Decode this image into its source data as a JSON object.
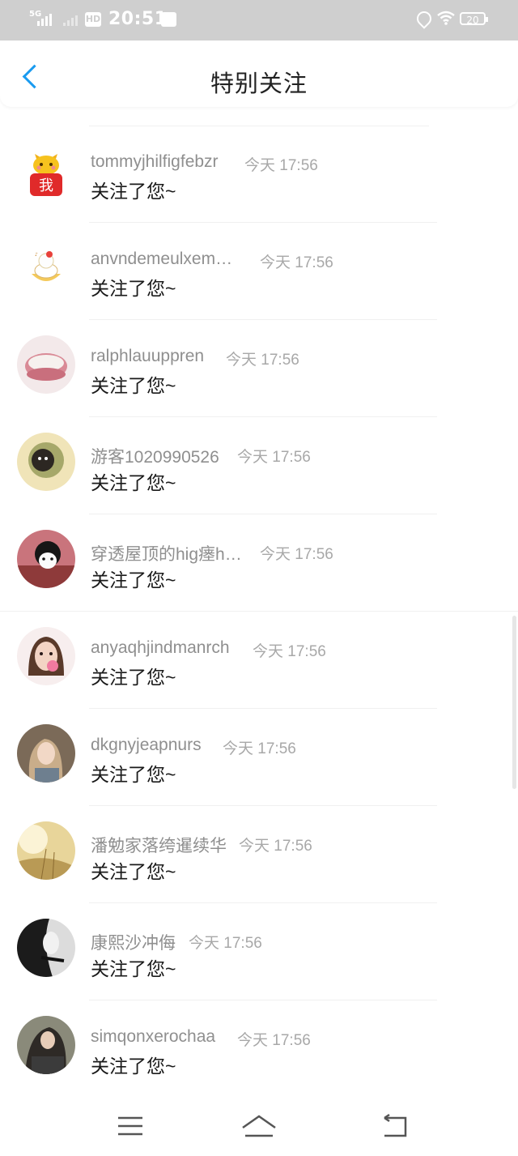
{
  "status_bar": {
    "network": "5G",
    "hd_badge": "HD",
    "time": "20:51",
    "battery": "20"
  },
  "header": {
    "title": "特别关注",
    "back_icon": "chevron-left-icon",
    "accent": "#1a9bf0"
  },
  "notifications": [
    {
      "user": "tommyjhilfigfebzr",
      "time": "今天 17:56",
      "message": "关注了您~"
    },
    {
      "user": "anvndemeulxem…",
      "time": "今天 17:56",
      "message": "关注了您~"
    },
    {
      "user": "ralphlauuppren",
      "time": "今天 17:56",
      "message": "关注了您~"
    },
    {
      "user": "游客1020990526",
      "time": "今天 17:56",
      "message": "关注了您~"
    },
    {
      "user": "穿透屋顶的hig瘗h…",
      "time": "今天 17:56",
      "message": "关注了您~"
    },
    {
      "user": "anyaqhjindmanrch",
      "time": "今天 17:56",
      "message": "关注了您~"
    },
    {
      "user": "dkgnyjeapnurs",
      "time": "今天 17:56",
      "message": "关注了您~"
    },
    {
      "user": "潘勉家落绔暹续华",
      "time": "今天 17:56",
      "message": "关注了您~"
    },
    {
      "user": "康熙沙冲侮",
      "time": "今天 17:56",
      "message": "关注了您~"
    },
    {
      "user": "simqonxerochaa",
      "time": "今天 17:56",
      "message": "关注了您~"
    }
  ],
  "avatar_badge": "我",
  "system_nav": {
    "menu_icon": "menu-icon",
    "home_icon": "home-icon",
    "back_icon": "back-icon"
  }
}
